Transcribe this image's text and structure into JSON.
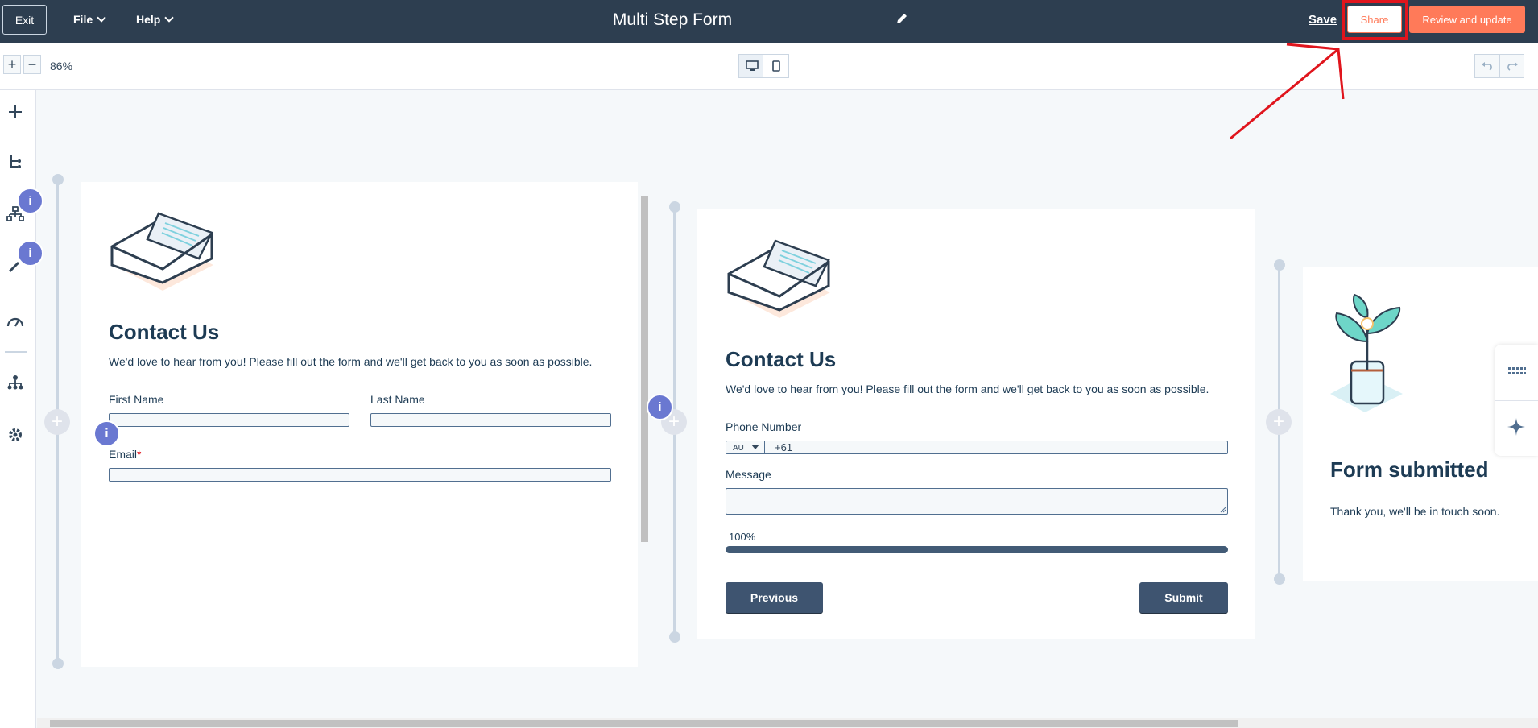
{
  "topbar": {
    "exit_label": "Exit",
    "file_label": "File",
    "help_label": "Help",
    "title": "Multi Step Form",
    "save_label": "Save",
    "share_label": "Share",
    "review_label": "Review and update"
  },
  "toolbar": {
    "zoom_in": "+",
    "zoom_out": "−",
    "zoom_level": "86%"
  },
  "sidebar": {
    "icons": [
      "plus-icon",
      "tree-icon",
      "sitemap-icon",
      "brush-icon",
      "gauge-icon",
      "hierarchy-icon",
      "gear-icon"
    ],
    "badge": "i"
  },
  "step1": {
    "title": "Contact Us",
    "description": "We'd love to hear from you! Please fill out the form and we'll get back to you as soon as possible.",
    "first_name_label": "First Name",
    "last_name_label": "Last Name",
    "email_label": "Email",
    "required_mark": "*"
  },
  "step2": {
    "title": "Contact Us",
    "description": "We'd love to hear from you! Please fill out the form and we'll get back to you as soon as possible.",
    "phone_label": "Phone Number",
    "country_code": "AU",
    "phone_prefix": "+61",
    "message_label": "Message",
    "progress_text": "100%",
    "progress_value": 100,
    "previous_label": "Previous",
    "submit_label": "Submit"
  },
  "step3": {
    "title": "Form submitted",
    "message": "Thank you, we'll be in touch soon."
  },
  "colors": {
    "topbar": "#2d3e50",
    "accent": "#ff7a59",
    "highlight": "#e0151d",
    "info_badge": "#6a78d1",
    "button_dark": "#3e5470"
  }
}
